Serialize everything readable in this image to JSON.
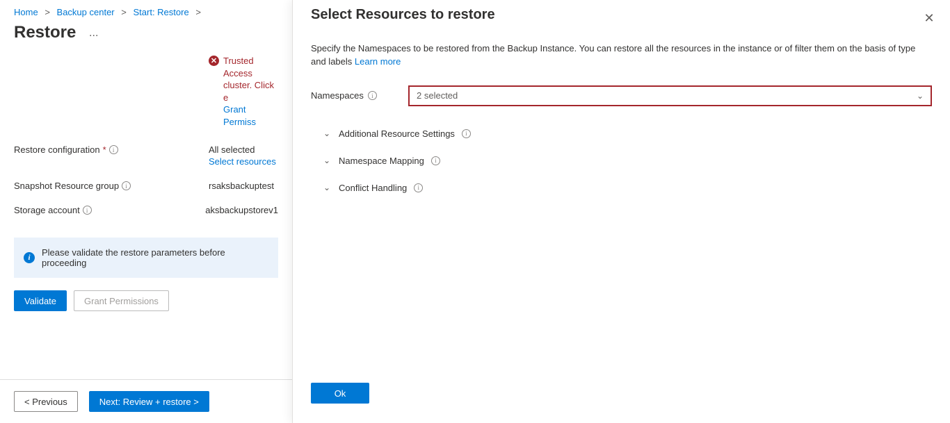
{
  "breadcrumb": {
    "items": [
      "Home",
      "Backup center",
      "Start: Restore"
    ],
    "sep": ">"
  },
  "page": {
    "title": "Restore",
    "ellipsis": "..."
  },
  "alert": {
    "text_line1": "Trusted Access",
    "text_line2": "cluster. Click e",
    "link": "Grant Permiss"
  },
  "form": {
    "restore_config_label": "Restore configuration",
    "restore_config_value": "All selected",
    "restore_config_link": "Select resources",
    "snapshot_group_label": "Snapshot Resource group",
    "snapshot_group_value": "rsaksbackuptest",
    "storage_account_label": "Storage account",
    "storage_account_value": "aksbackupstorev1"
  },
  "info_banner": {
    "text": "Please validate the restore parameters before proceeding"
  },
  "buttons": {
    "validate": "Validate",
    "grant_permissions": "Grant Permissions",
    "previous": "< Previous",
    "next": "Next: Review + restore >",
    "ok": "Ok"
  },
  "panel": {
    "title": "Select Resources to restore",
    "description": "Specify the Namespaces to be restored from the Backup Instance. You can restore all the resources in the instance or of filter them on the basis of type and labels ",
    "learn_more": "Learn more",
    "namespaces_label": "Namespaces",
    "namespaces_value": "2 selected",
    "sections": {
      "additional": "Additional Resource Settings",
      "mapping": "Namespace Mapping",
      "conflict": "Conflict Handling"
    }
  }
}
